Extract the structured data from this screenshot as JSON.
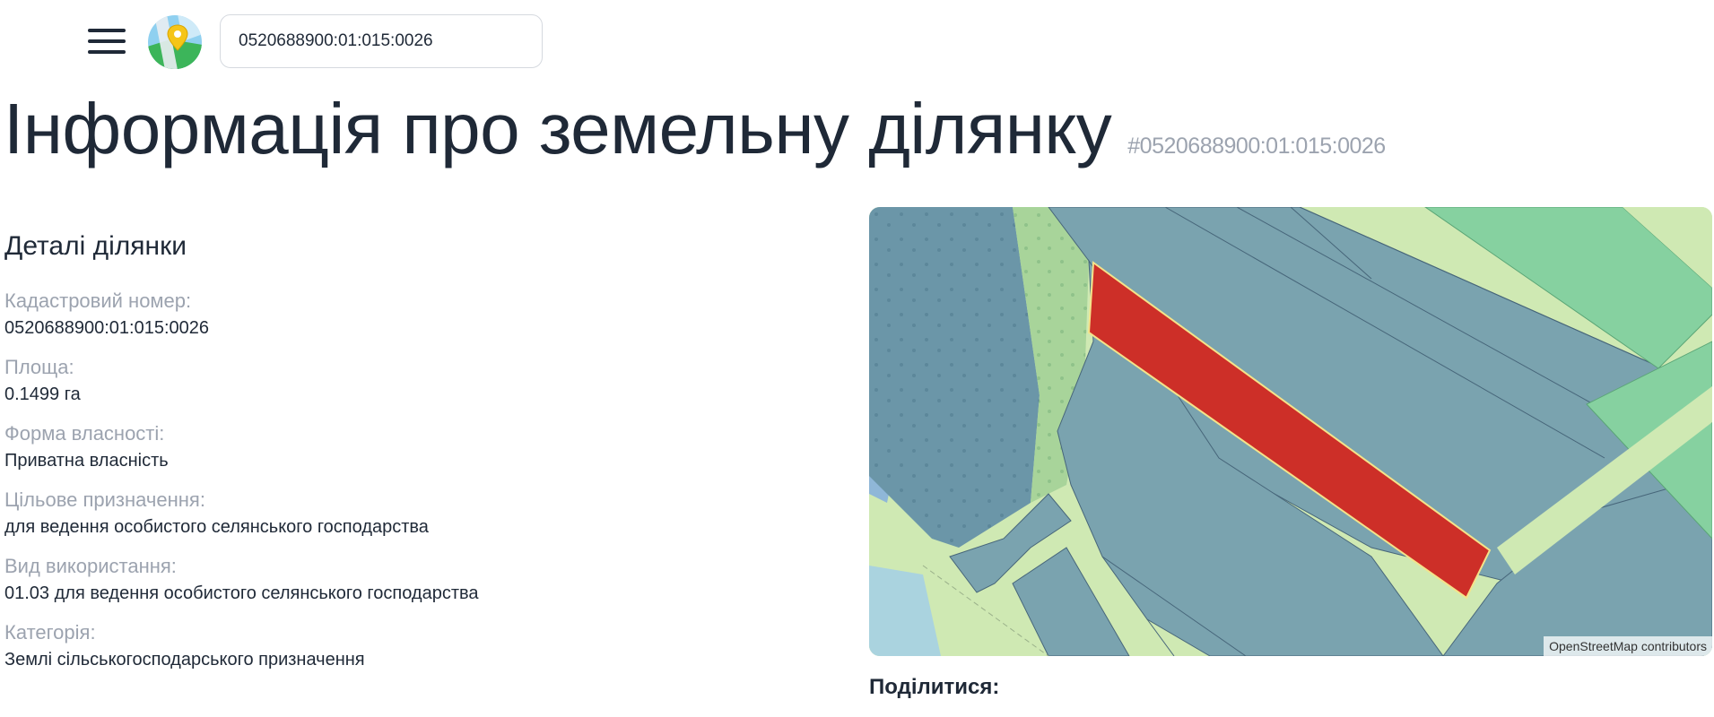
{
  "search": {
    "value": "0520688900:01:015:0026"
  },
  "page": {
    "title": "Інформація про земельну ділянку",
    "subtitle": "#0520688900:01:015:0026"
  },
  "details": {
    "heading": "Деталі ділянки",
    "fields": [
      {
        "label": "Кадастровий номер:",
        "value": "0520688900:01:015:0026"
      },
      {
        "label": "Площа:",
        "value": "0.1499 га"
      },
      {
        "label": "Форма власності:",
        "value": "Приватна власність"
      },
      {
        "label": "Цільове призначення:",
        "value": "для ведення особистого селянського господарства"
      },
      {
        "label": "Вид використання:",
        "value": "01.03 для ведення особистого селянського господарства"
      },
      {
        "label": "Категорія:",
        "value": "Землі сільськогосподарського призначення"
      }
    ]
  },
  "map": {
    "attribution": "OpenStreetMap contributors",
    "colors": {
      "parcel": "#7aa3af",
      "highlight": "#cd2f28",
      "grass": "#cfe9b3",
      "meadow": "#86d1a0",
      "forest": "#6b96a8",
      "water": "#aad3df"
    }
  },
  "share": {
    "label": "Поділитися:"
  }
}
